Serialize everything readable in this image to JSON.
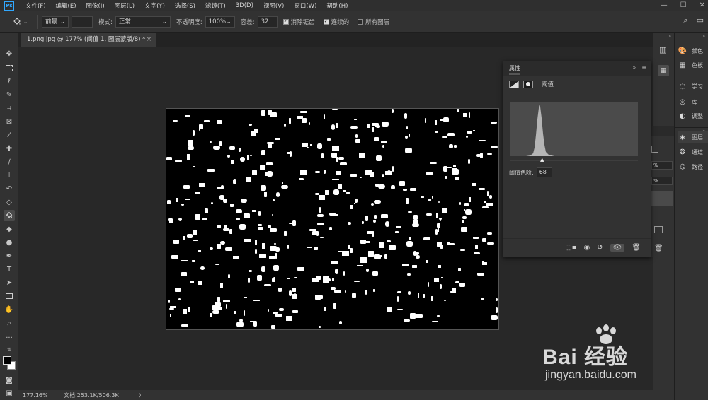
{
  "app": {
    "logo_text": "Ps"
  },
  "menu": [
    "文件(F)",
    "编辑(E)",
    "图像(I)",
    "图层(L)",
    "文字(Y)",
    "选择(S)",
    "滤镜(T)",
    "3D(D)",
    "视图(V)",
    "窗口(W)",
    "帮助(H)"
  ],
  "window_controls": [
    "—",
    "☐",
    "✕"
  ],
  "options": {
    "fill_source": "前景",
    "mode_label": "模式:",
    "mode_value": "正常",
    "opacity_label": "不透明度:",
    "opacity_value": "100%",
    "tolerance_label": "容差:",
    "tolerance_value": "32",
    "antialias_label": "消除锯齿",
    "antialias_checked": true,
    "contiguous_label": "连续的",
    "contiguous_checked": true,
    "all_layers_label": "所有图层",
    "all_layers_checked": false
  },
  "document_tab": {
    "title": "1.png.jpg @ 177% (阈值 1, 图层蒙版/8) *",
    "close": "×"
  },
  "status": {
    "zoom": "177.16%",
    "doc_info": "文档:253.1K/506.3K",
    "arrow": "〉"
  },
  "properties": {
    "title": "属性",
    "collapse": "»",
    "menu": "≡",
    "adjustment_label": "阈值",
    "threshold_label": "阈值色阶:",
    "threshold_value": "68",
    "histogram_peak_level": 68,
    "footer_icons": [
      "clip-to-layer",
      "view-previous",
      "reset",
      "visibility",
      "delete"
    ]
  },
  "right_panels": [
    {
      "icon": "color-icon",
      "label": "颜色"
    },
    {
      "icon": "swatches-icon",
      "label": "色板"
    },
    {
      "icon": "learn-icon",
      "label": "学习"
    },
    {
      "icon": "libraries-icon",
      "label": "库"
    },
    {
      "icon": "adjustments-icon",
      "label": "调整"
    },
    {
      "icon": "layers-icon",
      "label": "图层"
    },
    {
      "icon": "channels-icon",
      "label": "通道"
    },
    {
      "icon": "paths-icon",
      "label": "路径"
    }
  ],
  "layers_partial": {
    "opacity_partial": "%",
    "fill_partial": "%"
  },
  "watermark": {
    "brand": "Bai 经验",
    "url": "jingyan.baidu.com"
  },
  "colors": {
    "accent": "#31a8ff",
    "panel": "#323232",
    "canvas_bg": "#282828"
  }
}
